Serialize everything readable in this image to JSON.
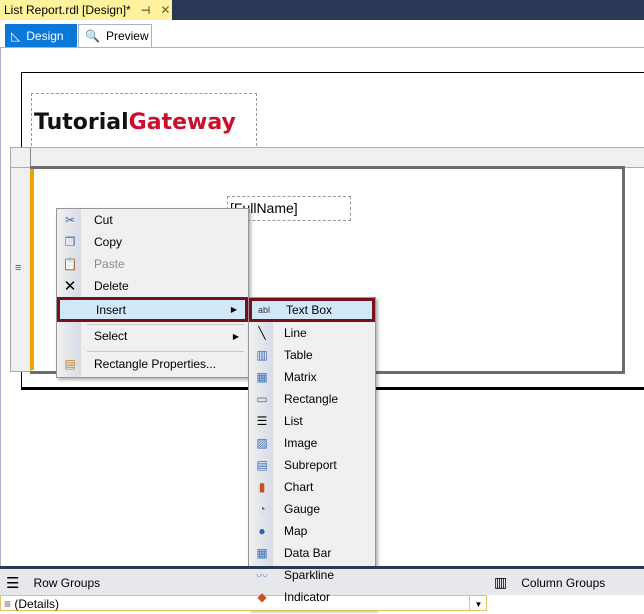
{
  "document_tab": {
    "title": "List Report.rdl [Design]*",
    "pin_icon": "pin-icon",
    "close_icon": "close-icon"
  },
  "view_tabs": [
    {
      "label": "Design",
      "icon": "ruler-triangle-icon",
      "active": true
    },
    {
      "label": "Preview",
      "icon": "preview-icon",
      "active": false
    }
  ],
  "report": {
    "logo_part1": "Tutorial",
    "logo_part2": "Gateway",
    "field": "[FullName]"
  },
  "context_menu": {
    "items": [
      {
        "label": "Cut",
        "icon": "scissors-icon"
      },
      {
        "label": "Copy",
        "icon": "copy-icon"
      },
      {
        "label": "Paste",
        "icon": "paste-icon",
        "disabled": true
      },
      {
        "label": "Delete",
        "icon": "delete-icon"
      },
      {
        "label": "Insert",
        "submenu": true,
        "highlighted": true
      },
      {
        "label": "Select",
        "submenu": true
      },
      {
        "label": "Rectangle Properties...",
        "icon": "properties-icon"
      }
    ]
  },
  "insert_submenu": {
    "items": [
      {
        "label": "Text Box",
        "icon": "textbox-icon",
        "highlighted": true
      },
      {
        "label": "Line",
        "icon": "line-icon"
      },
      {
        "label": "Table",
        "icon": "table-icon"
      },
      {
        "label": "Matrix",
        "icon": "matrix-icon"
      },
      {
        "label": "Rectangle",
        "icon": "rectangle-icon"
      },
      {
        "label": "List",
        "icon": "list-icon"
      },
      {
        "label": "Image",
        "icon": "image-icon"
      },
      {
        "label": "Subreport",
        "icon": "subreport-icon"
      },
      {
        "label": "Chart",
        "icon": "chart-icon"
      },
      {
        "label": "Gauge",
        "icon": "gauge-icon"
      },
      {
        "label": "Map",
        "icon": "map-icon"
      },
      {
        "label": "Data Bar",
        "icon": "databar-icon"
      },
      {
        "label": "Sparkline",
        "icon": "sparkline-icon"
      },
      {
        "label": "Indicator",
        "icon": "indicator-icon"
      }
    ]
  },
  "groups_panel": {
    "row_groups": "Row Groups",
    "column_groups": "Column Groups",
    "details": "(Details)"
  },
  "colors": {
    "accent": "#0a78d7",
    "highlight_border": "#7a0f1e",
    "doc_tab": "#fff29d",
    "chrome": "#293955"
  }
}
